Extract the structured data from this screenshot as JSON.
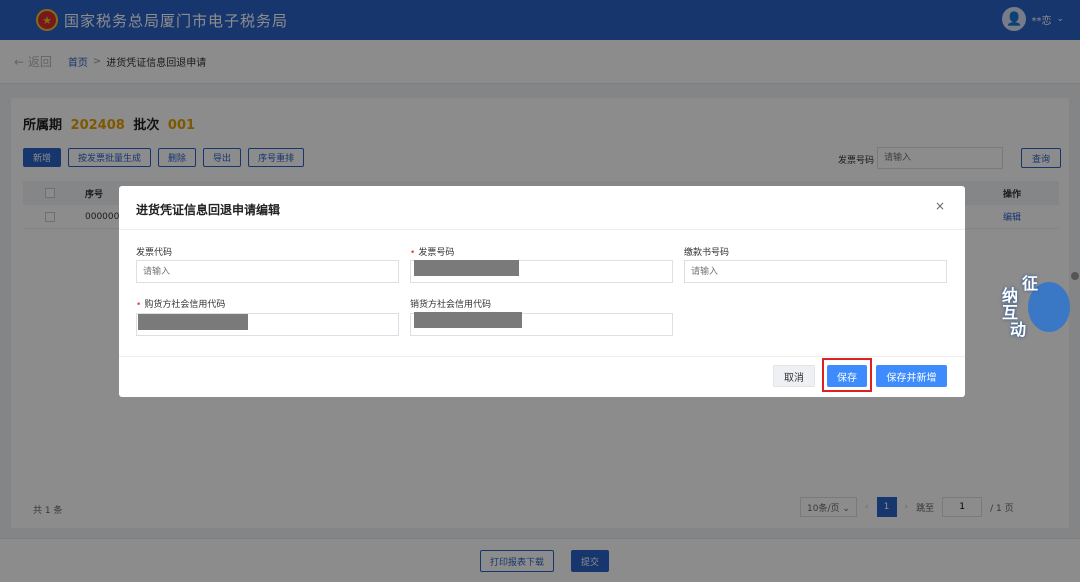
{
  "header": {
    "site_title": "国家税务总局厦门市电子税务局",
    "emblem_char": "★",
    "user_name": "**恋",
    "user_caret": "⌄"
  },
  "breadcrumb": {
    "back": "← 返回",
    "home": "首页",
    "separator": ">",
    "current": "进货凭证信息回退申请"
  },
  "period": {
    "label": "所属期",
    "value": "202408",
    "batch_label": "批次",
    "batch_value": "001"
  },
  "toolbar": {
    "add": "新增",
    "batch_generate": "按发票批量生成",
    "delete": "删除",
    "export": "导出",
    "reorder": "序号重排",
    "search_label": "发票号码",
    "search_placeholder": "请输入",
    "query": "查询"
  },
  "table": {
    "headers": {
      "seq": "序号",
      "op": "操作"
    },
    "rows": [
      {
        "seq": "000000",
        "op": "编辑"
      }
    ]
  },
  "pagination": {
    "total": "共 1 条",
    "page_size": "10条/页 ⌄",
    "prev": "‹",
    "current": "1",
    "next": "›",
    "jump_label": "跳至",
    "jump_value": "1",
    "page_total": "/ 1 页"
  },
  "bottom": {
    "print": "打印报表下载",
    "submit": "提交"
  },
  "modal": {
    "title": "进货凭证信息回退申请编辑",
    "close": "×",
    "fields": {
      "invoice_code_label": "发票代码",
      "invoice_code_placeholder": "请输入",
      "invoice_number_label": "发票号码",
      "payment_no_label": "缴款书号码",
      "payment_no_placeholder": "请输入",
      "buyer_code_label": "购货方社会信用代码",
      "seller_code_label": "销货方社会信用代码",
      "required_mark": "•"
    },
    "buttons": {
      "cancel": "取消",
      "save": "保存",
      "save_and_new": "保存并新增"
    }
  },
  "mascot": {
    "chars": [
      "征",
      "纳",
      "互",
      "动"
    ]
  },
  "colors": {
    "brand": "#2b63c9",
    "accent_button": "#3d8bfd",
    "highlight": "#e02020",
    "period_value": "#e6a100"
  }
}
